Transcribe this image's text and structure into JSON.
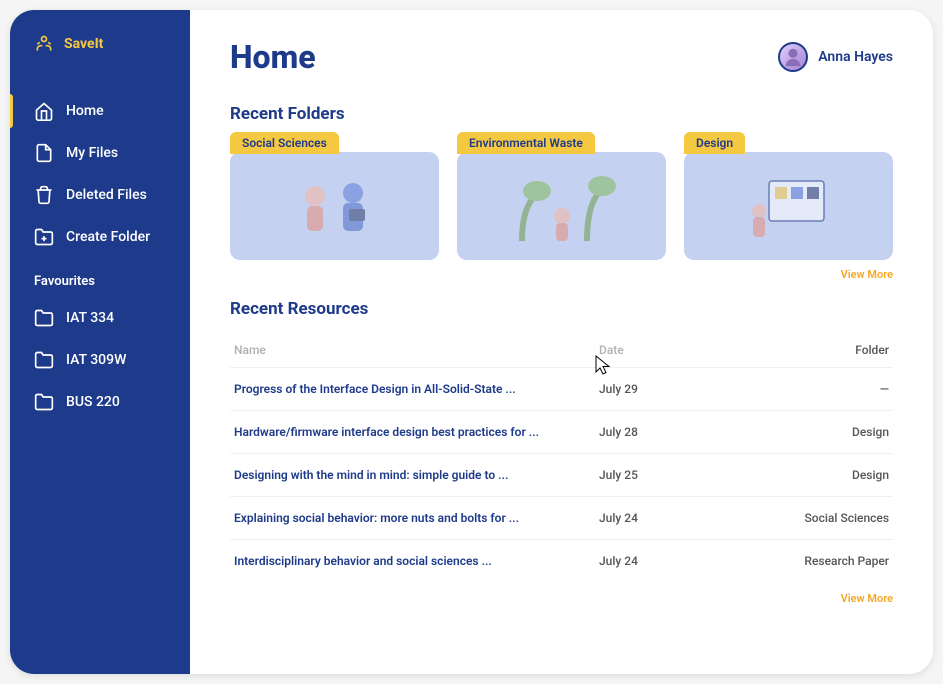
{
  "brand": {
    "name": "SaveIt"
  },
  "nav": {
    "items": [
      {
        "label": "Home",
        "icon": "home",
        "active": true
      },
      {
        "label": "My Files",
        "icon": "file",
        "active": false
      },
      {
        "label": "Deleted Files",
        "icon": "trash",
        "active": false
      },
      {
        "label": "Create Folder",
        "icon": "folder-plus",
        "active": false
      }
    ],
    "favourites_label": "Favourites",
    "favourites": [
      {
        "label": "IAT 334"
      },
      {
        "label": "IAT 309W"
      },
      {
        "label": "BUS 220"
      }
    ]
  },
  "header": {
    "title": "Home",
    "user_name": "Anna Hayes"
  },
  "recent_folders": {
    "title": "Recent Folders",
    "view_more": "View More",
    "items": [
      {
        "label": "Social Sciences"
      },
      {
        "label": "Environmental Waste"
      },
      {
        "label": "Design"
      }
    ]
  },
  "recent_resources": {
    "title": "Recent Resources",
    "view_more": "View More",
    "columns": {
      "name": "Name",
      "date": "Date",
      "folder": "Folder"
    },
    "rows": [
      {
        "name": "Progress of the Interface Design in All-Solid-State ...",
        "date": "July 29",
        "folder": "—"
      },
      {
        "name": "Hardware/firmware interface design best practices for ...",
        "date": "July 28",
        "folder": "Design"
      },
      {
        "name": "Designing with the mind in mind: simple guide to ...",
        "date": "July 25",
        "folder": "Design"
      },
      {
        "name": "Explaining social behavior: more nuts and bolts for ...",
        "date": "July 24",
        "folder": "Social Sciences"
      },
      {
        "name": "Interdisciplinary behavior and social sciences ...",
        "date": "July 24",
        "folder": "Research Paper"
      }
    ]
  }
}
